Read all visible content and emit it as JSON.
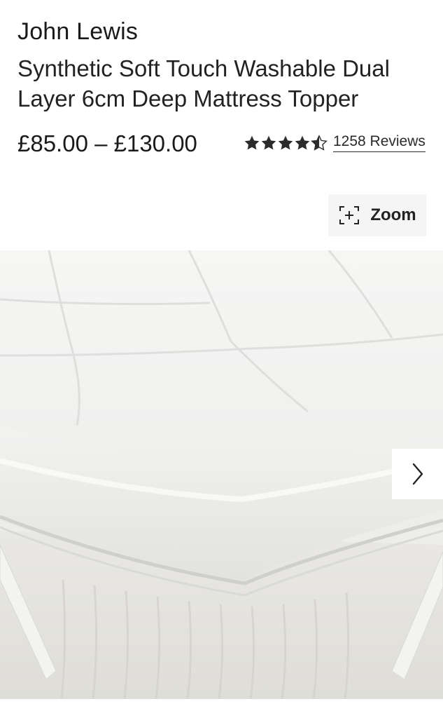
{
  "product": {
    "brand": "John Lewis",
    "title": "Synthetic Soft Touch Washable Dual Layer 6cm Deep Mattress Topper",
    "price_range": "£85.00 – £130.00",
    "rating": {
      "stars": 4.5,
      "out_of": 5,
      "reviews_text": "1258 Reviews"
    }
  },
  "gallery": {
    "zoom_label": "Zoom",
    "zoom_icon": "zoom-expand-icon",
    "next_icon": "chevron-right-icon",
    "image_subject": "mattress-topper-photo"
  },
  "colors": {
    "text": "#1a1a1a",
    "star": "#2b2b2b",
    "zoom_bg": "#f5f5f5",
    "image_bg": "#ececeb"
  }
}
